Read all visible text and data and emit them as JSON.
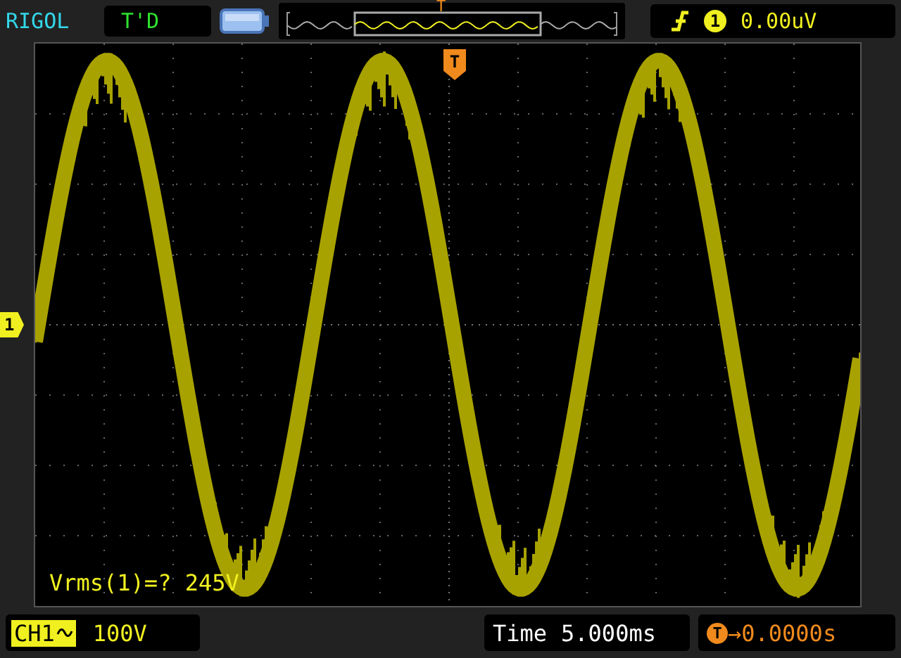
{
  "top_bar": {
    "brand": "RIGOL",
    "run_status": "T'D",
    "trigger_position_marker": "T",
    "trigger": {
      "source": "1",
      "level": "0.00uV"
    }
  },
  "screen": {
    "channel_marker": "1",
    "trigger_marker": "T",
    "measurement": "Vrms(1)=? 245V"
  },
  "bottom_bar": {
    "channel": {
      "label": "CH1",
      "scale": "100V"
    },
    "timebase": {
      "label": "Time",
      "value": "5.000ms"
    },
    "trigger_offset": {
      "badge": "T",
      "arrow": "→",
      "value": "0.0000s"
    }
  }
}
